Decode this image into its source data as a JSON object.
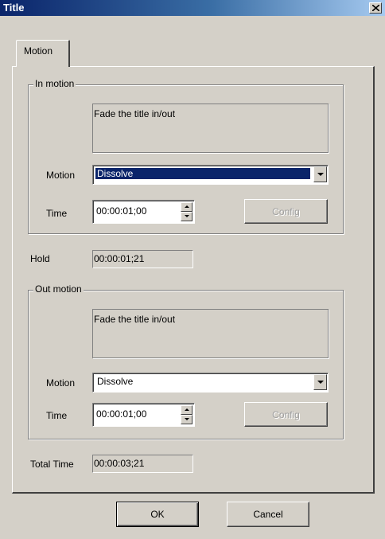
{
  "window": {
    "title": "Title"
  },
  "tabs": [
    {
      "label": "Motion"
    }
  ],
  "in_motion": {
    "label": "In motion",
    "description": "Fade the title in/out",
    "motion_label": "Motion",
    "motion_value": "Dissolve",
    "time_label": "Time",
    "time_value": "00:00:01;00",
    "config_label": "Config"
  },
  "hold": {
    "label": "Hold",
    "value": "00:00:01;21"
  },
  "out_motion": {
    "label": "Out motion",
    "description": "Fade the title in/out",
    "motion_label": "Motion",
    "motion_value": "Dissolve",
    "time_label": "Time",
    "time_value": "00:00:01;00",
    "config_label": "Config"
  },
  "total_time": {
    "label": "Total Time",
    "value": "00:00:03;21"
  },
  "buttons": {
    "ok": "OK",
    "cancel": "Cancel"
  },
  "colors": {
    "face": "#d4d0c8",
    "titlebar": "#0a246a",
    "selection": "#0a246a"
  },
  "icons": [
    "close-icon",
    "dropdown-arrow-icon",
    "spin-up-icon",
    "spin-down-icon"
  ]
}
